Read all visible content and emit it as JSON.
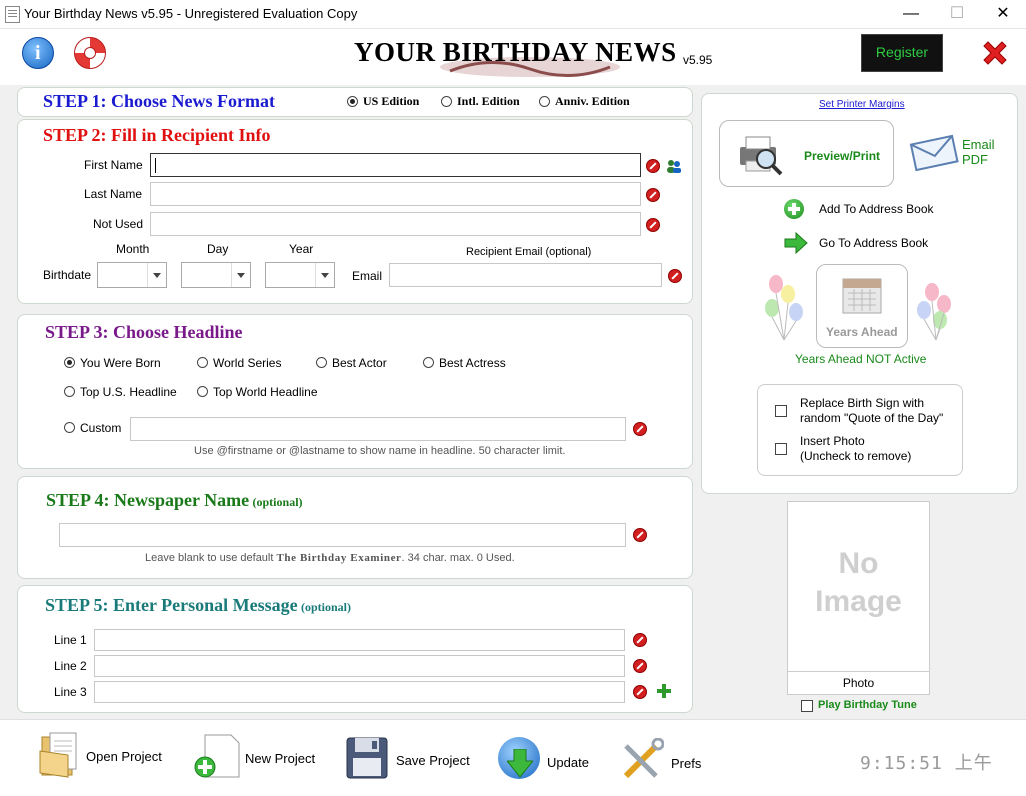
{
  "window": {
    "title": "Your Birthday News v5.95 - Unregistered Evaluation Copy",
    "minimize": "—",
    "maximize": "☐",
    "close": "✕"
  },
  "header": {
    "logo_title": "YOUR BIRTHDAY NEWS",
    "version": "v5.95",
    "register_label": "Register"
  },
  "step1": {
    "title": "STEP 1: Choose News Format",
    "options": [
      "US Edition",
      "Intl. Edition",
      "Anniv. Edition"
    ],
    "selected": "US Edition"
  },
  "step2": {
    "title": "STEP 2: Fill in Recipient Info",
    "first_name_label": "First Name",
    "last_name_label": "Last Name",
    "not_used_label": "Not Used",
    "birthdate_label": "Birthdate",
    "month_label": "Month",
    "day_label": "Day",
    "year_label": "Year",
    "email_caption": "Recipient Email (optional)",
    "email_label": "Email",
    "first_name": "",
    "last_name": "",
    "not_used": "",
    "email": ""
  },
  "step3": {
    "title": "STEP 3: Choose Headline",
    "options": [
      "You Were Born",
      "World Series",
      "Best Actor",
      "Best Actress",
      "Top U.S. Headline",
      "Top World Headline",
      "Custom"
    ],
    "selected": "You Were Born",
    "custom_value": "",
    "hint": "Use @firstname or @lastname to show name in headline. 50 character limit."
  },
  "step4": {
    "title": "STEP 4: Newspaper Name",
    "optional": "(optional)",
    "value": "",
    "hint_pre": "Leave blank to use default ",
    "hint_name": "The Birthday Examiner",
    "hint_post": ". 34 char. max. 0 Used."
  },
  "step5": {
    "title": "STEP 5: Enter Personal Message",
    "optional": "(optional)",
    "line1_label": "Line 1",
    "line2_label": "Line 2",
    "line3_label": "Line 3"
  },
  "right": {
    "printer_margins": "Set Printer Margins",
    "preview_print": "Preview/Print",
    "email_pdf_1": "Email",
    "email_pdf_2": "PDF",
    "add_address": "Add To Address Book",
    "go_address": "Go To Address Book",
    "years_ahead": "Years Ahead",
    "years_ahead_status": "Years Ahead NOT Active",
    "replace_sign_1": "Replace Birth Sign with",
    "replace_sign_2": "random \"Quote of the Day\"",
    "insert_photo_1": "Insert Photo",
    "insert_photo_2": "(Uncheck to remove)",
    "no_image_1": "No",
    "no_image_2": "Image",
    "photo_label": "Photo",
    "play_tune": "Play Birthday Tune"
  },
  "toolbar": {
    "open": "Open Project",
    "new": "New Project",
    "save": "Save Project",
    "update": "Update",
    "prefs": "Prefs",
    "clock": "9:15:51 上午"
  },
  "colors": {
    "step1": "#1a1ad0",
    "step2": "#e01010",
    "step3": "#7a1a8a",
    "step4": "#1a7a1a",
    "step5": "#1a7a7a",
    "green_text": "#1a8a1a"
  }
}
